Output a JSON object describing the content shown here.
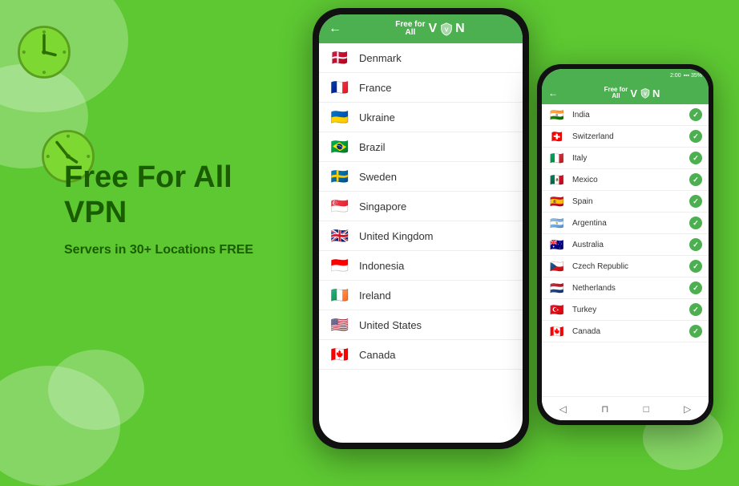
{
  "background_color": "#5dc832",
  "left_content": {
    "title_line1": "Free For All",
    "title_line2": "VPN",
    "subtitle": "Servers in 30+ Locations FREE"
  },
  "main_phone": {
    "header": {
      "back_label": "←",
      "logo_text_top": "Free for",
      "logo_text_bottom": "All",
      "vpn_label": "VPN"
    },
    "countries": [
      {
        "flag": "🇩🇰",
        "name": "Denmark"
      },
      {
        "flag": "🇫🇷",
        "name": "France"
      },
      {
        "flag": "🇺🇦",
        "name": "Ukraine"
      },
      {
        "flag": "🇧🇷",
        "name": "Brazil"
      },
      {
        "flag": "🇸🇪",
        "name": "Sweden"
      },
      {
        "flag": "🇸🇬",
        "name": "Singapore"
      },
      {
        "flag": "🇬🇧",
        "name": "United Kingdom"
      },
      {
        "flag": "🇮🇩",
        "name": "Indonesia"
      },
      {
        "flag": "🇮🇪",
        "name": "Ireland"
      },
      {
        "flag": "🇺🇸",
        "name": "United States"
      },
      {
        "flag": "🇨🇦",
        "name": "Canada"
      }
    ]
  },
  "secondary_phone": {
    "status_bar": "2:00",
    "header": {
      "back_label": "←",
      "logo_text_top": "Free for",
      "logo_text_bottom": "All",
      "vpn_label": "VPN"
    },
    "countries": [
      {
        "flag": "🇮🇳",
        "name": "India",
        "checked": true
      },
      {
        "flag": "🇨🇭",
        "name": "Switzerland",
        "checked": true
      },
      {
        "flag": "🇮🇹",
        "name": "Italy",
        "checked": true
      },
      {
        "flag": "🇲🇽",
        "name": "Mexico",
        "checked": true
      },
      {
        "flag": "🇪🇸",
        "name": "Spain",
        "checked": true
      },
      {
        "flag": "🇦🇷",
        "name": "Argentina",
        "checked": true
      },
      {
        "flag": "🇦🇺",
        "name": "Australia",
        "checked": true
      },
      {
        "flag": "🇨🇿",
        "name": "Czech Republic",
        "checked": true
      },
      {
        "flag": "🇳🇱",
        "name": "Netherlands",
        "checked": true
      },
      {
        "flag": "🇹🇷",
        "name": "Turkey",
        "checked": true
      },
      {
        "flag": "🇨🇦",
        "name": "Canada",
        "checked": true
      }
    ],
    "bottom_nav": [
      "◁",
      "⬜",
      "□",
      "△"
    ]
  },
  "clocks": [
    {
      "id": "clock-1",
      "position": "top-left"
    },
    {
      "id": "clock-2",
      "position": "middle-left"
    }
  ]
}
